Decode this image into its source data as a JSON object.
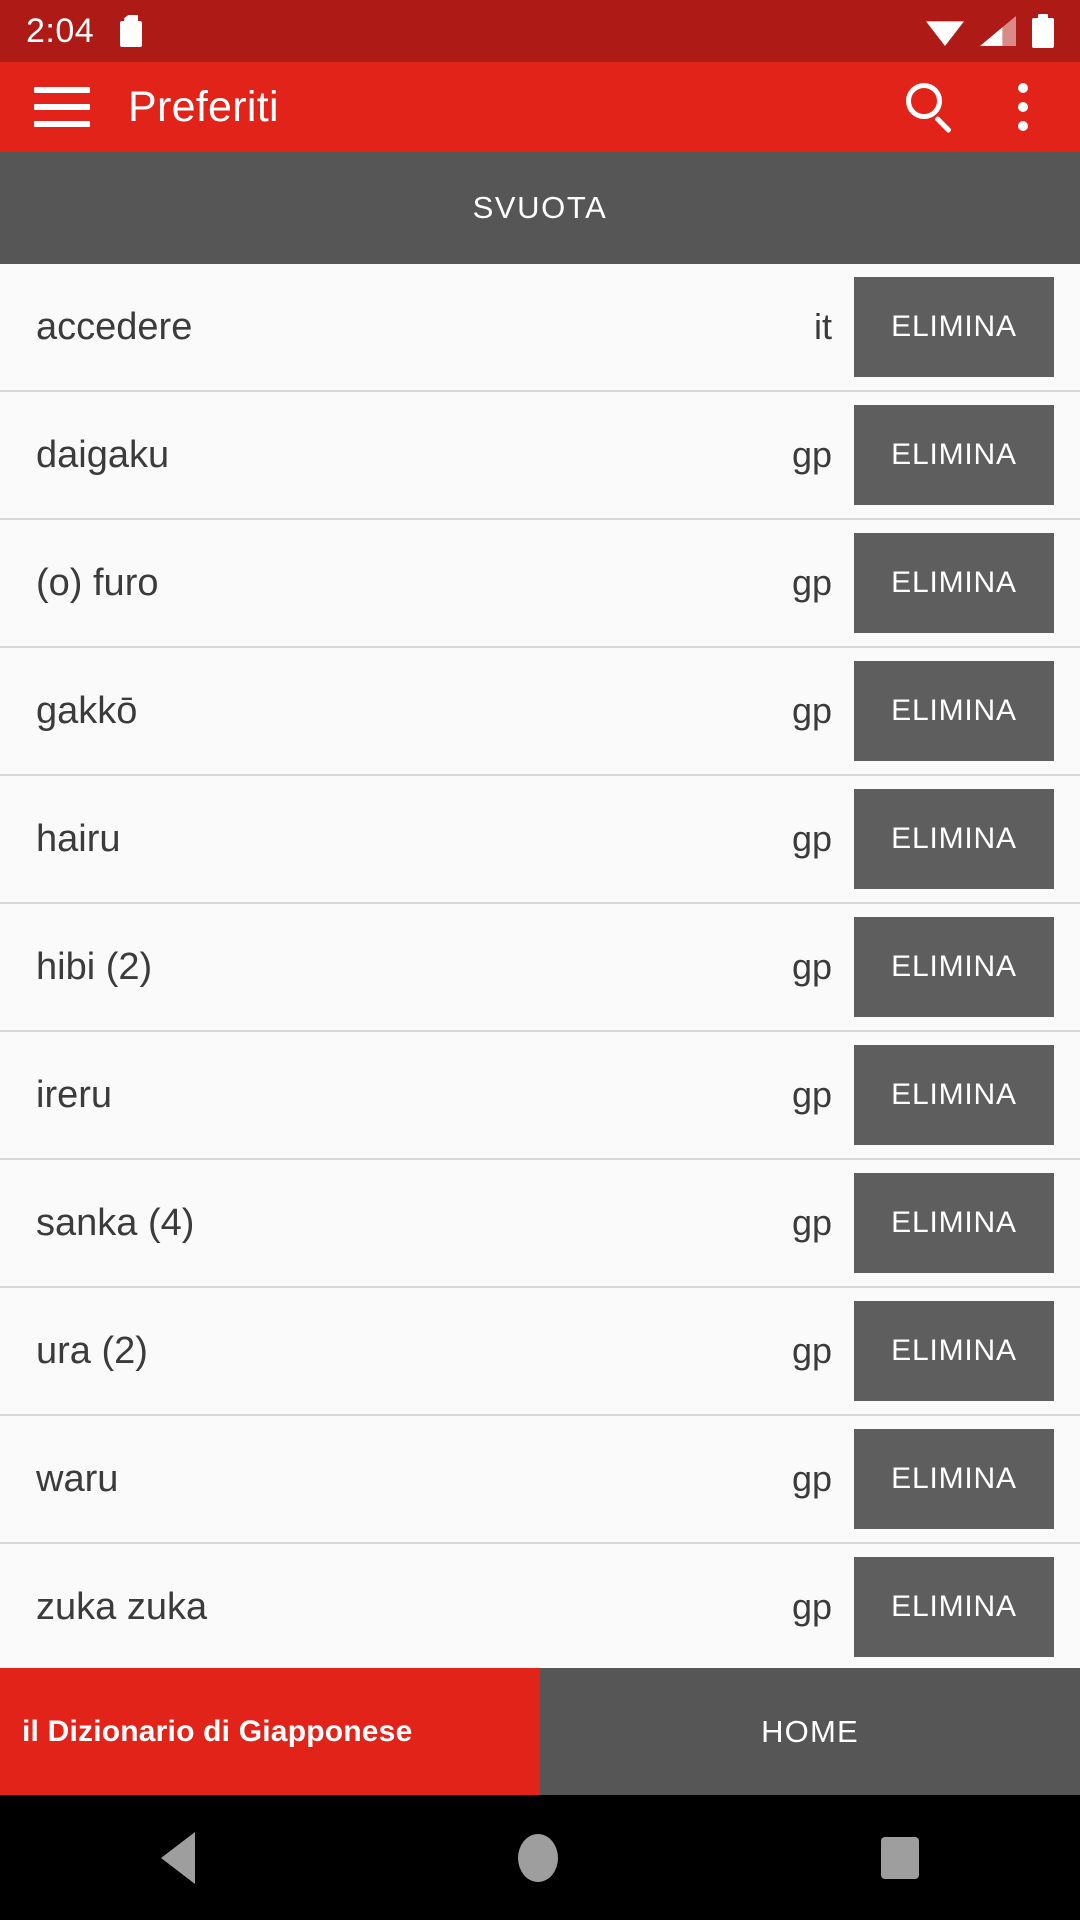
{
  "status_bar": {
    "time": "2:04",
    "icons": [
      "sd-card-icon",
      "wifi-icon",
      "cellular-signal-icon",
      "battery-icon"
    ],
    "background_color": "#AE1B16"
  },
  "app_bar": {
    "menu_icon": "hamburger-menu-icon",
    "title": "Preferiti",
    "search_icon": "search-icon",
    "overflow_icon": "more-vertical-icon",
    "background_color": "#E2231A"
  },
  "clear_bar": {
    "label": "SVUOTA",
    "background_color": "#565656"
  },
  "list": {
    "delete_label": "ELIMINA",
    "items": [
      {
        "word": "accedere",
        "lang": "it"
      },
      {
        "word": "daigaku",
        "lang": "gp"
      },
      {
        "word": "(o) furo",
        "lang": "gp"
      },
      {
        "word": "gakkō",
        "lang": "gp"
      },
      {
        "word": "hairu",
        "lang": "gp"
      },
      {
        "word": "hibi (2)",
        "lang": "gp"
      },
      {
        "word": "ireru",
        "lang": "gp"
      },
      {
        "word": "sanka (4)",
        "lang": "gp"
      },
      {
        "word": "ura (2)",
        "lang": "gp"
      },
      {
        "word": "waru",
        "lang": "gp"
      },
      {
        "word": "zuka zuka",
        "lang": "gp"
      }
    ]
  },
  "bottom_bar": {
    "brand_label": "il Dizionario di Giapponese",
    "brand_color": "#E2231A",
    "home_label": "HOME",
    "home_color": "#565656"
  },
  "nav_bar": {
    "back_icon": "triangle-back-icon",
    "home_icon": "circle-home-icon",
    "recents_icon": "square-recents-icon",
    "background_color": "#000000"
  }
}
